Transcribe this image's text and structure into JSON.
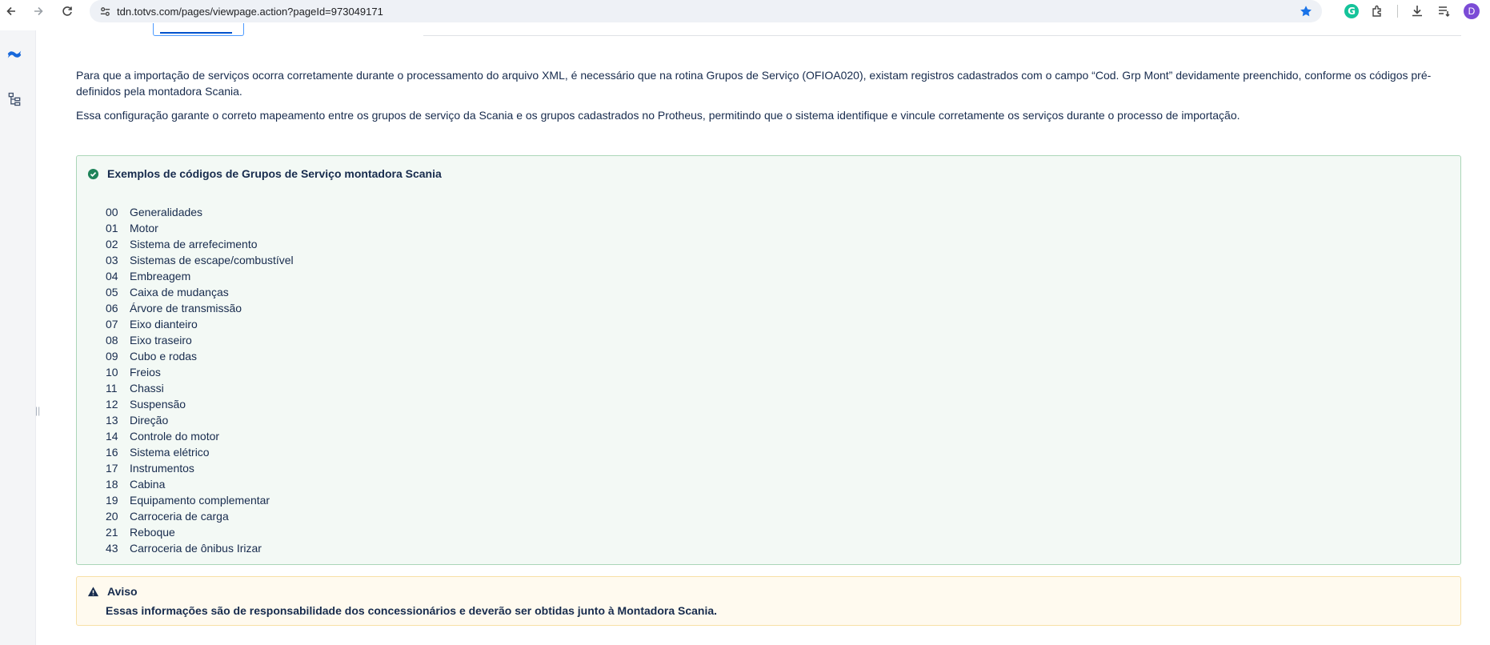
{
  "browser": {
    "url": "tdn.totvs.com/pages/viewpage.action?pageId=973049171",
    "profile_initial": "D",
    "grammarly_letter": "G"
  },
  "intro": {
    "paragraph1": "Para que a importação de serviços ocorra corretamente durante o processamento do arquivo XML, é necessário que na rotina Grupos de Serviço (OFIOA020), existam registros cadastrados com o campo “Cod. Grp Mont” devidamente preenchido, conforme os códigos pré-definidos pela montadora Scania.",
    "paragraph2": "Essa configuração garante o correto mapeamento entre os grupos de serviço da Scania e os grupos cadastrados no Protheus, permitindo que o sistema identifique e vincule corretamente os serviços durante o processo de importação."
  },
  "success_panel": {
    "title": "Exemplos de códigos de Grupos de Serviço montadora Scania",
    "items": [
      {
        "code": "00",
        "name": "Generalidades"
      },
      {
        "code": "01",
        "name": "Motor"
      },
      {
        "code": "02",
        "name": "Sistema de arrefecimento"
      },
      {
        "code": "03",
        "name": "Sistemas de escape/combustível"
      },
      {
        "code": "04",
        "name": "Embreagem"
      },
      {
        "code": "05",
        "name": "Caixa de mudanças"
      },
      {
        "code": "06",
        "name": "Árvore de transmissão"
      },
      {
        "code": "07",
        "name": "Eixo dianteiro"
      },
      {
        "code": "08",
        "name": "Eixo traseiro"
      },
      {
        "code": "09",
        "name": "Cubo e rodas"
      },
      {
        "code": "10",
        "name": "Freios"
      },
      {
        "code": "11",
        "name": "Chassi"
      },
      {
        "code": "12",
        "name": "Suspensão"
      },
      {
        "code": "13",
        "name": "Direção"
      },
      {
        "code": "14",
        "name": "Controle do motor"
      },
      {
        "code": "16",
        "name": "Sistema elétrico"
      },
      {
        "code": "17",
        "name": "Instrumentos"
      },
      {
        "code": "18",
        "name": "Cabina"
      },
      {
        "code": "19",
        "name": "Equipamento complementar"
      },
      {
        "code": "20",
        "name": "Carroceria de carga"
      },
      {
        "code": "21",
        "name": "Reboque"
      },
      {
        "code": "43",
        "name": "Carroceria de ônibus Irizar"
      }
    ]
  },
  "warning_panel": {
    "title": "Aviso",
    "text": "Essas informações são de responsabilidade dos concessionários e deverão ser obtidas junto à Montadora Scania."
  },
  "colors": {
    "success_bg": "#f3f9f5",
    "success_border": "#abd6b8",
    "success_icon": "#1f845a",
    "warning_bg": "#fffaef",
    "warning_border": "#f7e0a6",
    "brand": "#1868db"
  },
  "icons": [
    "back-icon",
    "forward-icon",
    "reload-icon",
    "site-info-icon",
    "star-icon",
    "grammarly-icon",
    "extensions-icon",
    "download-icon",
    "reading-list-icon",
    "confluence-logo-icon",
    "page-tree-icon",
    "check-circle-icon",
    "warning-icon"
  ]
}
